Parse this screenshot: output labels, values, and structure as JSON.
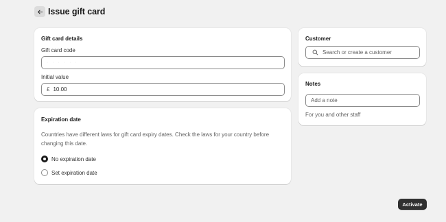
{
  "header": {
    "title": "Issue gift card",
    "back_icon": "arrow-left-icon"
  },
  "gift_card_details": {
    "title": "Gift card details",
    "code_label": "Gift card code",
    "code_value": "· · · · · ·",
    "initial_value_label": "Initial value",
    "currency_symbol": "£",
    "initial_value": "10.00"
  },
  "expiration": {
    "title": "Expiration date",
    "help_line1": "Countries have different laws for gift card expiry dates. Check the laws for your country before",
    "help_line2": "changing this date.",
    "options": [
      {
        "label": "No expiration date",
        "checked": true
      },
      {
        "label": "Set expiration date",
        "checked": false
      }
    ]
  },
  "customer": {
    "title": "Customer",
    "search_placeholder": "Search or create a customer",
    "search_icon": "search-icon"
  },
  "notes": {
    "title": "Notes",
    "placeholder": "Add a note",
    "help": "For you and other staff"
  },
  "actions": {
    "activate_label": "Activate"
  },
  "colors": {
    "background": "#f1f1f1",
    "card": "#ffffff",
    "primary_button": "#303030"
  }
}
